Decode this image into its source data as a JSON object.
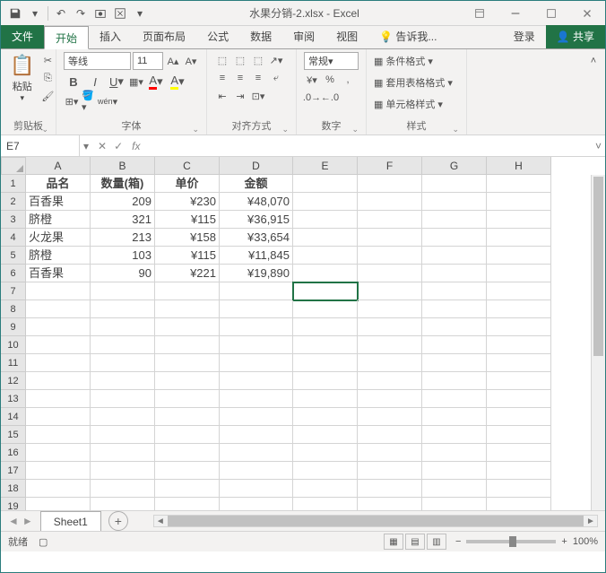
{
  "title": "水果分销-2.xlsx - Excel",
  "tabs": {
    "file": "文件",
    "home": "开始",
    "insert": "插入",
    "layout": "页面布局",
    "formulas": "公式",
    "data": "数据",
    "review": "审阅",
    "view": "视图",
    "tell": "告诉我...",
    "login": "登录",
    "share": "共享"
  },
  "ribbon": {
    "clipboard": {
      "paste": "粘贴",
      "label": "剪贴板"
    },
    "font": {
      "name": "等线",
      "size": "11",
      "label": "字体"
    },
    "align": {
      "label": "对齐方式"
    },
    "number": {
      "format": "常规",
      "label": "数字"
    },
    "styles": {
      "cond": "条件格式",
      "table": "套用表格格式",
      "cell": "单元格样式",
      "label": "样式"
    }
  },
  "namebox": "E7",
  "columns": [
    "A",
    "B",
    "C",
    "D",
    "E",
    "F",
    "G",
    "H"
  ],
  "rows": 19,
  "headers": [
    "品名",
    "数量(箱)",
    "单价",
    "金额"
  ],
  "data": [
    [
      "百香果",
      "209",
      "¥230",
      "¥48,070"
    ],
    [
      "脐橙",
      "321",
      "¥115",
      "¥36,915"
    ],
    [
      "火龙果",
      "213",
      "¥158",
      "¥33,654"
    ],
    [
      "脐橙",
      "103",
      "¥115",
      "¥11,845"
    ],
    [
      "百香果",
      "90",
      "¥221",
      "¥19,890"
    ]
  ],
  "selected": {
    "row": 7,
    "col": 5
  },
  "sheet": "Sheet1",
  "status": "就绪",
  "zoom": "100%",
  "chart_data": {
    "type": "table",
    "title": "水果分销",
    "columns": [
      "品名",
      "数量(箱)",
      "单价",
      "金额"
    ],
    "rows": [
      {
        "品名": "百香果",
        "数量(箱)": 209,
        "单价": 230,
        "金额": 48070
      },
      {
        "品名": "脐橙",
        "数量(箱)": 321,
        "单价": 115,
        "金额": 36915
      },
      {
        "品名": "火龙果",
        "数量(箱)": 213,
        "单价": 158,
        "金额": 33654
      },
      {
        "品名": "脐橙",
        "数量(箱)": 103,
        "单价": 115,
        "金额": 11845
      },
      {
        "品名": "百香果",
        "数量(箱)": 90,
        "单价": 221,
        "金额": 19890
      }
    ]
  }
}
